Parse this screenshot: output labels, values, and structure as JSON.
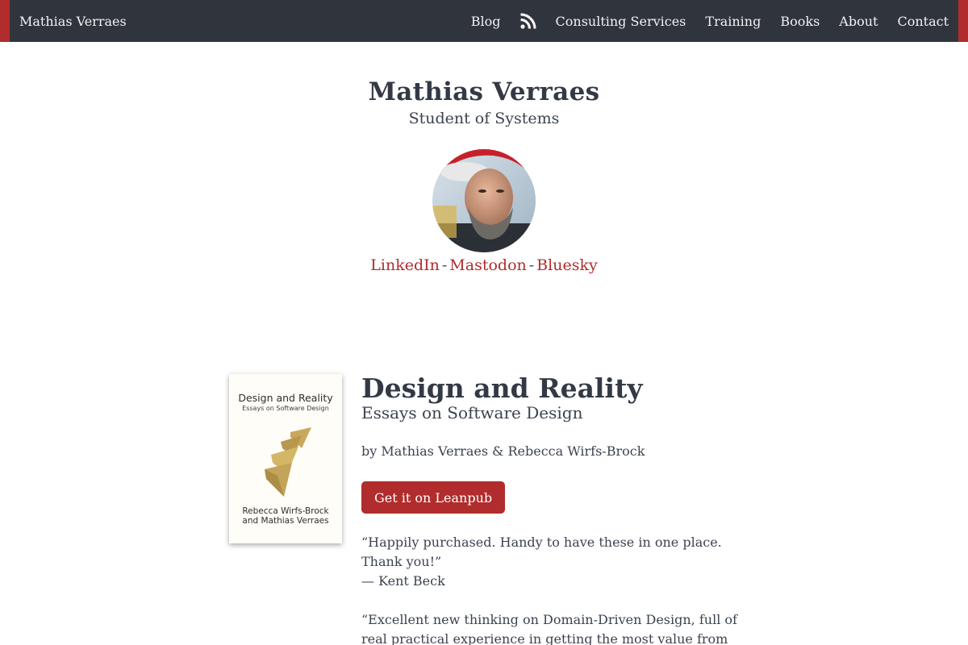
{
  "nav": {
    "brand": "Mathias Verraes",
    "links": {
      "blog": "Blog",
      "consulting": "Consulting Services",
      "training": "Training",
      "books": "Books",
      "about": "About",
      "contact": "Contact"
    },
    "rss_icon": "rss-icon"
  },
  "header": {
    "title": "Mathias Verraes",
    "subtitle": "Student of Systems",
    "social": {
      "linkedin": "LinkedIn",
      "mastodon": "Mastodon",
      "bluesky": "Bluesky",
      "separator": "-"
    }
  },
  "book": {
    "cover": {
      "title": "Design and Reality",
      "subtitle": "Essays on Software Design",
      "authors_line1": "Rebecca Wirfs-Brock",
      "authors_line2": "and Mathias Verraes"
    },
    "title": "Design and Reality",
    "subtitle": "Essays on Software Design",
    "authors": "by Mathias Verraes & Rebecca Wirfs-Brock",
    "button_label": "Get it on Leanpub",
    "testimonials": [
      {
        "quote": "“Happily purchased. Handy to have these in one place. Thank you!”",
        "attribution": "— Kent Beck"
      },
      {
        "quote": "“Excellent new thinking on Domain-Driven Design, full of real practical experience in getting the most value from"
      }
    ]
  },
  "colors": {
    "accent": "#b12c2c",
    "nav_bg": "#2f343d",
    "text": "#333a45"
  }
}
